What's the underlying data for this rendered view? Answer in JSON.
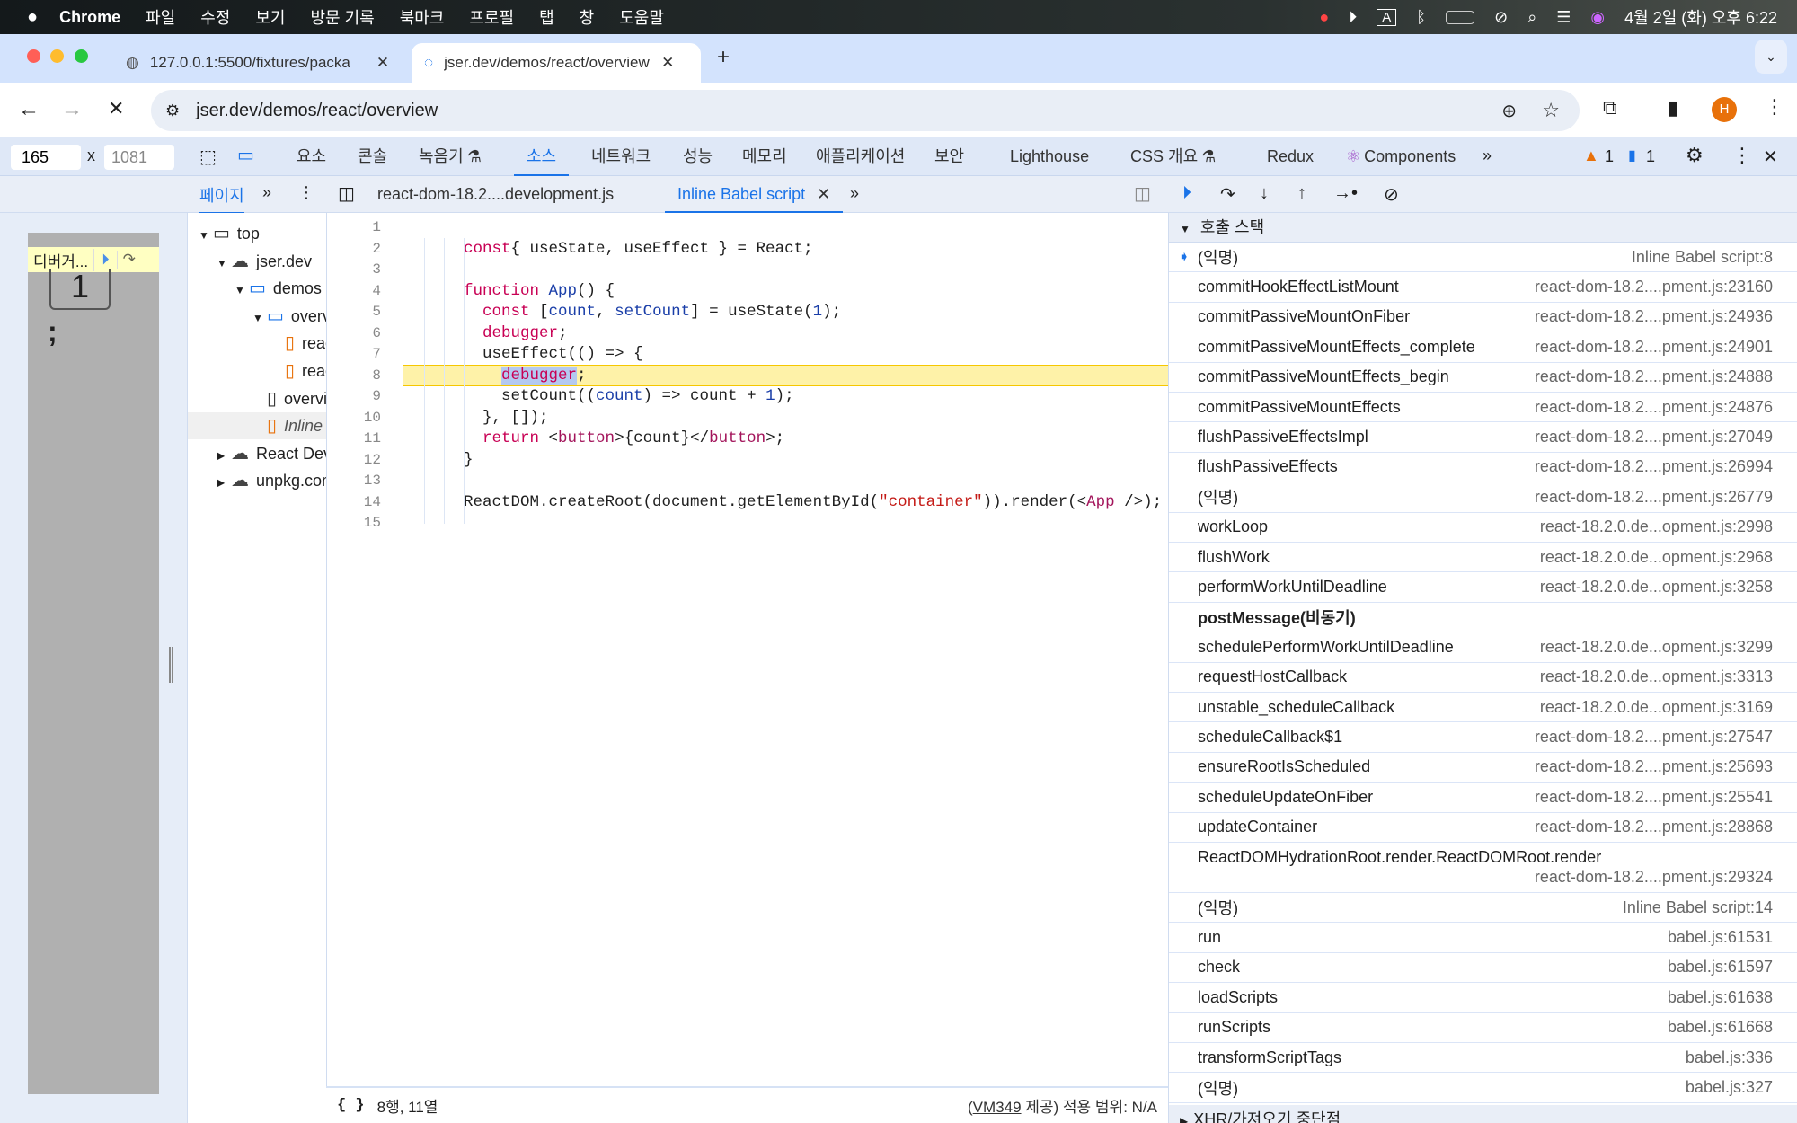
{
  "menubar": {
    "app": "Chrome",
    "items": [
      "파일",
      "수정",
      "보기",
      "방문 기록",
      "북마크",
      "프로필",
      "탭",
      "창",
      "도움말"
    ],
    "clock": "4월 2일 (화) 오후 6:22"
  },
  "tabs": [
    {
      "title": "127.0.0.1:5500/fixtures/packa",
      "active": false
    },
    {
      "title": "jser.dev/demos/react/overview",
      "active": true
    }
  ],
  "address": {
    "url": "jser.dev/demos/react/overview",
    "profile_initial": "H"
  },
  "devtools": {
    "dim_width": "165",
    "dim_height": "1081",
    "dim_sep": "x",
    "tabs": [
      "요소",
      "콘솔",
      "녹음기",
      "소스",
      "네트워크",
      "성능",
      "메모리",
      "애플리케이션",
      "보안",
      "Lighthouse",
      "CSS 개요",
      "Redux",
      "Components"
    ],
    "active_tab": "소스",
    "warnings": "1",
    "messages": "1",
    "nav_tab": "페이지",
    "file_tabs": [
      "react-dom-18.2....development.js",
      "Inline Babel script"
    ],
    "accent": "#1a73e8"
  },
  "paused_overlay": {
    "label": "디버거...",
    "button_text": "1",
    "semicolon": ";"
  },
  "tree": [
    {
      "label": "top",
      "depth": 0,
      "icon": "frame",
      "open": true
    },
    {
      "label": "jser.dev",
      "depth": 1,
      "icon": "cloud",
      "open": true
    },
    {
      "label": "demos",
      "depth": 2,
      "icon": "folder",
      "open": true
    },
    {
      "label": "overview",
      "depth": 3,
      "icon": "folder",
      "open": true
    },
    {
      "label": "react-dom",
      "depth": 4,
      "icon": "file-orange"
    },
    {
      "label": "react",
      "depth": 4,
      "icon": "file-orange"
    },
    {
      "label": "overview",
      "depth": 3,
      "icon": "file"
    },
    {
      "label": "Inline Babel script",
      "depth": 3,
      "icon": "file-orange",
      "selected": true
    },
    {
      "label": "React DevTools",
      "depth": 1,
      "icon": "cloud",
      "open": false
    },
    {
      "label": "unpkg.com",
      "depth": 1,
      "icon": "cloud",
      "open": false
    }
  ],
  "code": {
    "current_line": 8,
    "lines": [
      [],
      [
        [
          "kw",
          "const"
        ],
        [
          "",
          "{ useState, useEffect } = React;"
        ]
      ],
      [],
      [
        [
          "kw",
          "function"
        ],
        [
          "",
          " "
        ],
        [
          "fn",
          "App"
        ],
        [
          "",
          "() {"
        ]
      ],
      [
        [
          "",
          "  "
        ],
        [
          "kw",
          "const"
        ],
        [
          "",
          " ["
        ],
        [
          "fn",
          "count"
        ],
        [
          "",
          ", "
        ],
        [
          "fn",
          "setCount"
        ],
        [
          "",
          "] = useState("
        ],
        [
          "num",
          "1"
        ],
        [
          "",
          ");"
        ]
      ],
      [
        [
          "",
          "  "
        ],
        [
          "kw",
          "debugger"
        ],
        [
          "",
          ";"
        ]
      ],
      [
        [
          "",
          "  useEffect(() => {"
        ]
      ],
      [
        [
          "",
          "    "
        ],
        [
          "kw hl",
          "debugger"
        ],
        [
          "",
          ";"
        ]
      ],
      [
        [
          "",
          "    setCount(("
        ],
        [
          "fn",
          "count"
        ],
        [
          "",
          ") => count + "
        ],
        [
          "num",
          "1"
        ],
        [
          "",
          ");"
        ]
      ],
      [
        [
          "",
          "  }, []);"
        ]
      ],
      [
        [
          "",
          "  "
        ],
        [
          "kw",
          "return"
        ],
        [
          "",
          " <"
        ],
        [
          "tag",
          "button"
        ],
        [
          "",
          ">{count}</"
        ],
        [
          "tag",
          "button"
        ],
        [
          "",
          ">;"
        ]
      ],
      [
        [
          "",
          "}"
        ]
      ],
      [],
      [
        [
          "",
          "ReactDOM.createRoot(document.getElementById("
        ],
        [
          "str",
          "\"container\""
        ],
        [
          "",
          "))."
        ],
        [
          "",
          "render(<"
        ],
        [
          "tag",
          "App"
        ],
        [
          "",
          " />);"
        ]
      ],
      []
    ]
  },
  "status": {
    "position": "8행, 11열",
    "source_prefix": "(",
    "source_link": "VM349",
    "source_suffix": " 제공) 적용 범위: N/A"
  },
  "callstack": {
    "title": "호출 스택",
    "frames": [
      {
        "fn": "(익명)",
        "loc": "Inline Babel script:8",
        "current": true
      },
      {
        "fn": "commitHookEffectListMount",
        "loc": "react-dom-18.2....pment.js:23160"
      },
      {
        "fn": "commitPassiveMountOnFiber",
        "loc": "react-dom-18.2....pment.js:24936"
      },
      {
        "fn": "commitPassiveMountEffects_complete",
        "loc": "react-dom-18.2....pment.js:24901"
      },
      {
        "fn": "commitPassiveMountEffects_begin",
        "loc": "react-dom-18.2....pment.js:24888"
      },
      {
        "fn": "commitPassiveMountEffects",
        "loc": "react-dom-18.2....pment.js:24876"
      },
      {
        "fn": "flushPassiveEffectsImpl",
        "loc": "react-dom-18.2....pment.js:27049"
      },
      {
        "fn": "flushPassiveEffects",
        "loc": "react-dom-18.2....pment.js:26994"
      },
      {
        "fn": "(익명)",
        "loc": "react-dom-18.2....pment.js:26779"
      },
      {
        "fn": "workLoop",
        "loc": "react-18.2.0.de...opment.js:2998"
      },
      {
        "fn": "flushWork",
        "loc": "react-18.2.0.de...opment.js:2968"
      },
      {
        "fn": "performWorkUntilDeadline",
        "loc": "react-18.2.0.de...opment.js:3258"
      },
      {
        "fn": "postMessage(비동기)",
        "async": true
      },
      {
        "fn": "schedulePerformWorkUntilDeadline",
        "loc": "react-18.2.0.de...opment.js:3299"
      },
      {
        "fn": "requestHostCallback",
        "loc": "react-18.2.0.de...opment.js:3313"
      },
      {
        "fn": "unstable_scheduleCallback",
        "loc": "react-18.2.0.de...opment.js:3169"
      },
      {
        "fn": "scheduleCallback$1",
        "loc": "react-dom-18.2....pment.js:27547"
      },
      {
        "fn": "ensureRootIsScheduled",
        "loc": "react-dom-18.2....pment.js:25693"
      },
      {
        "fn": "scheduleUpdateOnFiber",
        "loc": "react-dom-18.2....pment.js:25541"
      },
      {
        "fn": "updateContainer",
        "loc": "react-dom-18.2....pment.js:28868"
      },
      {
        "fn": "ReactDOMHydrationRoot.render.ReactDOMRoot.render",
        "loc": "react-dom-18.2....pment.js:29324",
        "wrap": true
      },
      {
        "fn": "(익명)",
        "loc": "Inline Babel script:14"
      },
      {
        "fn": "run",
        "loc": "babel.js:61531"
      },
      {
        "fn": "check",
        "loc": "babel.js:61597"
      },
      {
        "fn": "loadScripts",
        "loc": "babel.js:61638"
      },
      {
        "fn": "runScripts",
        "loc": "babel.js:61668"
      },
      {
        "fn": "transformScriptTags",
        "loc": "babel.js:336"
      },
      {
        "fn": "(익명)",
        "loc": "babel.js:327"
      }
    ],
    "next_section": "XHR/가져오기 중단점"
  }
}
